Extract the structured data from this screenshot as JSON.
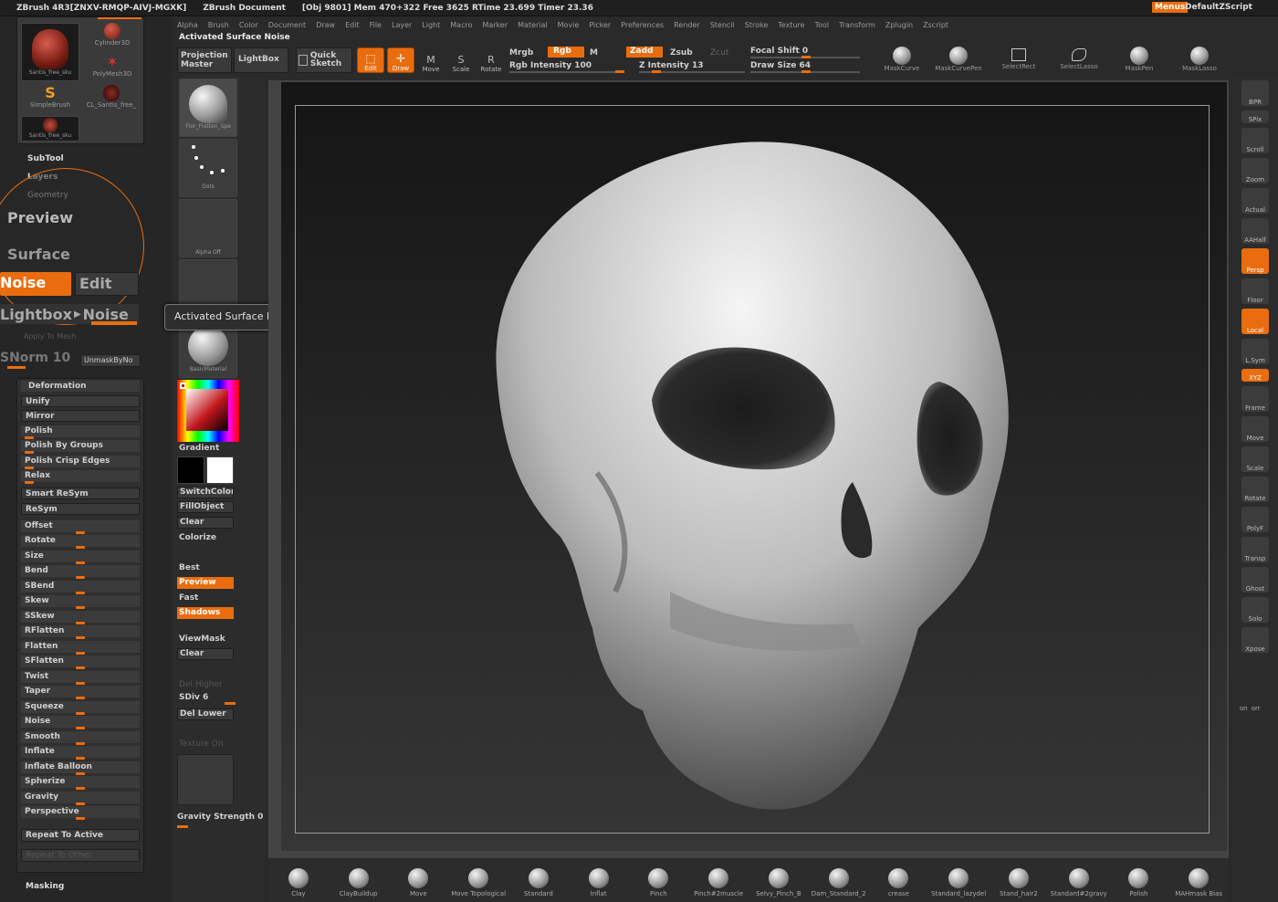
{
  "topbar": {
    "app": "ZBrush 4R3[ZNXV-RMQP-AIVJ-MGXK]",
    "doc": "ZBrush Document",
    "stats": "[Obj 9801] Mem 470+322 Free 3625 RTime 23.699 Timer 23.36",
    "menus_btn": "Menus",
    "script_btn": "DefaultZScript"
  },
  "menubar": [
    "Alpha",
    "Brush",
    "Color",
    "Document",
    "Draw",
    "Edit",
    "File",
    "Layer",
    "Light",
    "Macro",
    "Marker",
    "Material",
    "Movie",
    "Picker",
    "Preferences",
    "Render",
    "Stencil",
    "Stroke",
    "Texture",
    "Tool",
    "Transform",
    "Zplugin",
    "Zscript"
  ],
  "notice": "Activated Surface Noise",
  "toolbar": {
    "projection_master": "Projection Master",
    "lightbox": "LightBox",
    "quick_sketch": "Quick Sketch",
    "edit": "Edit",
    "draw": "Draw",
    "move": "Move",
    "scale": "Scale",
    "rotate": "Rotate",
    "mrgb": "Mrgb",
    "rgb": "Rgb",
    "m": "M",
    "zadd": "Zadd",
    "zsub": "Zsub",
    "zcut": "Zcut",
    "rgb_intensity": "Rgb Intensity 100",
    "z_intensity": "Z Intensity 13",
    "focal_shift": "Focal Shift 0",
    "draw_size": "Draw Size 64",
    "mask_tools": [
      "MaskCurve",
      "MaskCurvePen",
      "SelectRect",
      "SelectLasso",
      "MaskPen",
      "MaskLasso"
    ]
  },
  "tool_palette": {
    "thumbs": [
      "Santis_free_sku",
      "Cylinder3D",
      "PolyMesh3D",
      "SimpleBrush",
      "CL_Santis_free_",
      "Santis_free_sku"
    ],
    "subtool": "SubTool",
    "layers": "Layers",
    "geometry": "Geometry",
    "preview": "Preview",
    "surface": "Surface",
    "noise": "Noise",
    "edit": "Edit",
    "lightbox_noise": "Lightbox",
    "noise2": "Noise",
    "apply_to_mesh": "Apply To Mesh",
    "snorm": "SNorm 10",
    "unmask": "UnmaskByNo",
    "deformation": "Deformation",
    "deform_items": [
      "Unify",
      "Mirror",
      "Polish",
      "Polish By Groups",
      "Polish Crisp Edges",
      "Relax",
      "Smart ReSym",
      "ReSym",
      "Offset",
      "Rotate",
      "Size",
      "Bend",
      "SBend",
      "Skew",
      "SSkew",
      "RFlatten",
      "Flatten",
      "SFlatten",
      "Twist",
      "Taper",
      "Squeeze",
      "Noise",
      "Smooth",
      "Inflate",
      "Inflate Balloon",
      "Spherize",
      "Gravity",
      "Perspective"
    ],
    "repeat_active": "Repeat To Active",
    "repeat_other": "Repeat To Other",
    "masking": "Masking"
  },
  "left_shelf": {
    "brush_label": "Flor_Flatten_Spe",
    "stroke_label": "Dots",
    "alpha_label": "Alpha Off",
    "material_label": "BasicMaterial",
    "gradient": "Gradient",
    "switch_color": "SwitchColor",
    "fill_object": "FillObject",
    "clear": "Clear",
    "colorize": "Colorize",
    "best": "Best",
    "preview": "Preview",
    "fast": "Fast",
    "shadows": "Shadows",
    "viewmask": "ViewMask",
    "clear2": "Clear",
    "del_higher": "Del Higher",
    "sdiv": "SDiv 6",
    "del_lower": "Del Lower",
    "texture_on": "Texture On",
    "gravity": "Gravity Strength 0",
    "main_color": "#c0161b"
  },
  "tooltip": "Activated Surface Noise",
  "right_shelf": [
    "BPR",
    "SPix",
    "Scroll",
    "Zoom",
    "Actual",
    "AAHalf",
    "Persp",
    "Floor",
    "Local",
    "L.Sym",
    "XYZ",
    "Frame",
    "Move",
    "Scale",
    "Rotate",
    "PolyF",
    "Transp",
    "Ghost",
    "Solo",
    "Xpose"
  ],
  "right_extra": [
    "on",
    "orr"
  ],
  "brushes": [
    "Clay",
    "ClayBuildup",
    "Move",
    "Move Topological",
    "Standard",
    "Inflat",
    "Pinch",
    "Pinch#2muscle",
    "Selvy_Pinch_B",
    "Dam_Standard_2",
    "crease",
    "Standard_lazydel",
    "Stand_hair2",
    "Standard#2gravy",
    "Polish",
    "MAHmask Bias"
  ]
}
